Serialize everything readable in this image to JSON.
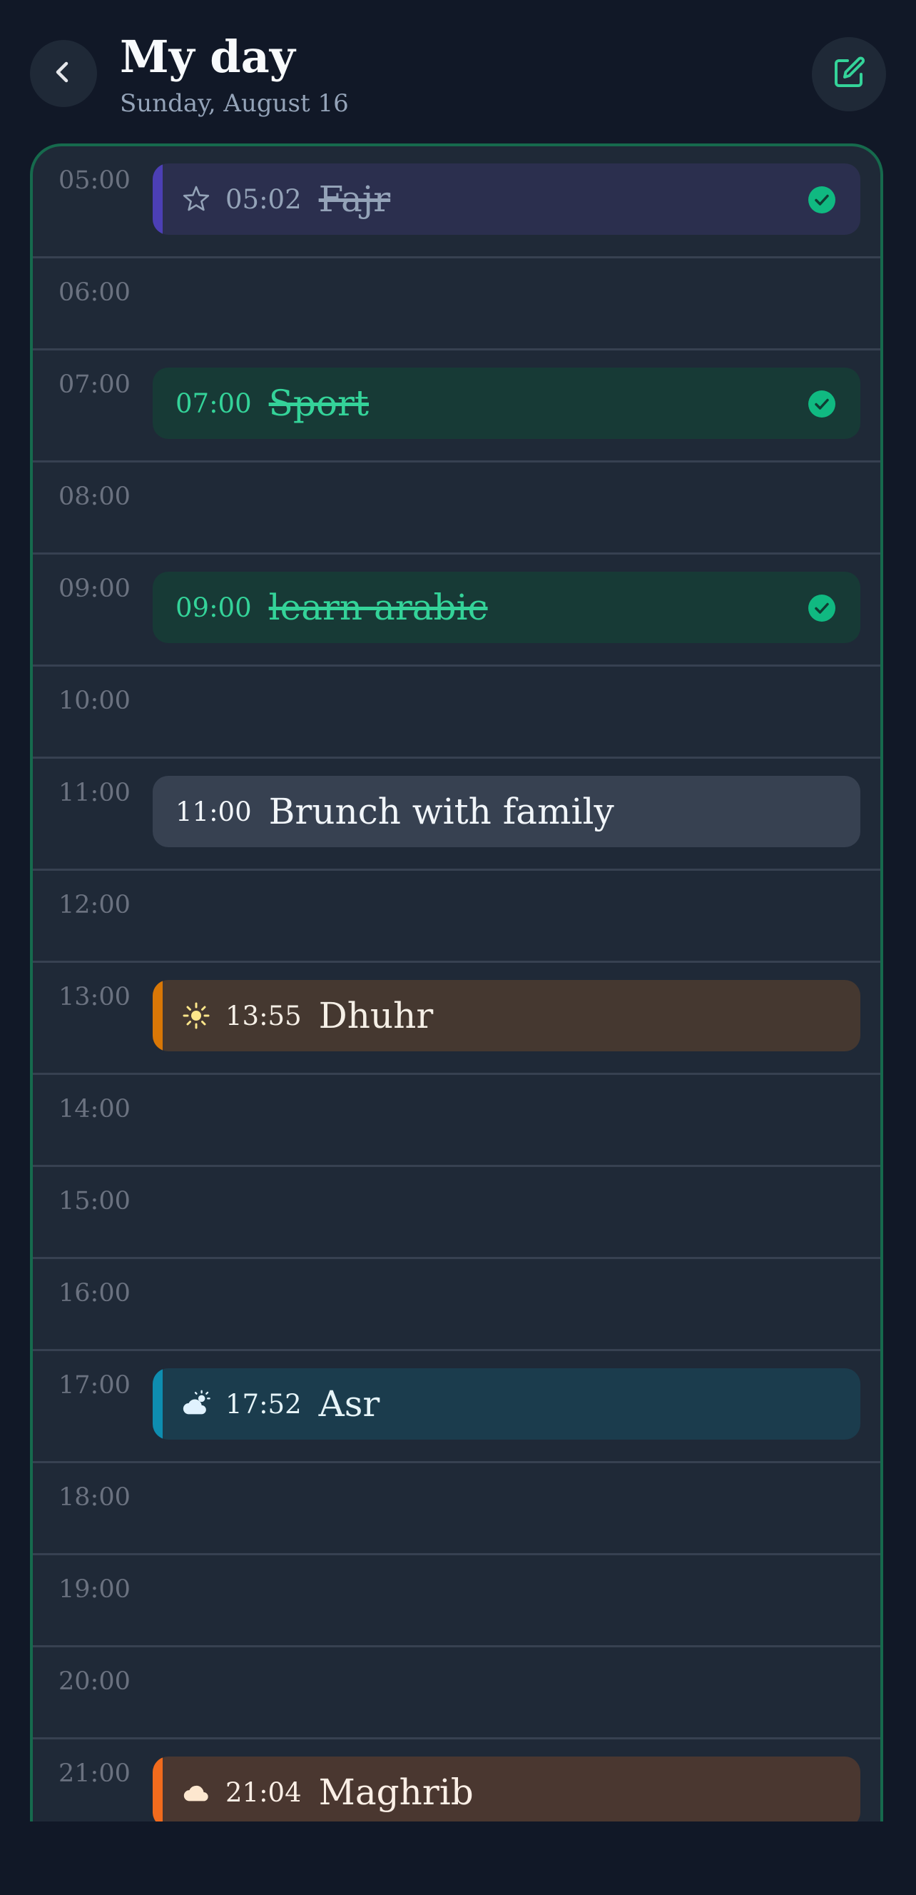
{
  "header": {
    "title": "My day",
    "date": "Sunday, August 16"
  },
  "colors": {
    "background": "#111827",
    "timeline_bg": "#1f2937",
    "timeline_border": "#166a4d",
    "accent_green": "#34d399",
    "check_green": "#10b981"
  },
  "icons": {
    "back": "chevron-left-icon",
    "edit": "edit-note-icon"
  },
  "hours": [
    {
      "label": "05:00",
      "event": {
        "time": "05:02",
        "title": "Fajr",
        "kind": "prayer",
        "icon": "star-icon",
        "done": true,
        "bg": "#2b2f4e",
        "bar": "#4c3fb5",
        "text": "#94a3b8"
      }
    },
    {
      "label": "06:00"
    },
    {
      "label": "07:00",
      "event": {
        "time": "07:00",
        "title": "Sport",
        "kind": "task",
        "done": true,
        "bg": "#173a36",
        "text": "#34d399"
      }
    },
    {
      "label": "08:00"
    },
    {
      "label": "09:00",
      "event": {
        "time": "09:00",
        "title": "learn arabic",
        "kind": "task",
        "done": true,
        "bg": "#173a36",
        "text": "#34d399"
      }
    },
    {
      "label": "10:00"
    },
    {
      "label": "11:00",
      "event": {
        "time": "11:00",
        "title": "Brunch with family",
        "kind": "task",
        "done": false,
        "bg": "#374151",
        "text": "#f1f5f9"
      }
    },
    {
      "label": "12:00"
    },
    {
      "label": "13:00",
      "event": {
        "time": "13:55",
        "title": "Dhuhr",
        "kind": "prayer",
        "icon": "sun-icon",
        "done": false,
        "bg": "#453830",
        "bar": "#d97706",
        "text": "#f5efe6"
      }
    },
    {
      "label": "14:00"
    },
    {
      "label": "15:00"
    },
    {
      "label": "16:00"
    },
    {
      "label": "17:00",
      "event": {
        "time": "17:52",
        "title": "Asr",
        "kind": "prayer",
        "icon": "cloud-sun-icon",
        "done": false,
        "bg": "#1b3c4d",
        "bar": "#0e8db0",
        "text": "#e6f4f8"
      }
    },
    {
      "label": "18:00"
    },
    {
      "label": "19:00"
    },
    {
      "label": "20:00"
    },
    {
      "label": "21:00",
      "event": {
        "time": "21:04",
        "title": "Maghrib",
        "kind": "prayer",
        "icon": "cloud-icon",
        "done": false,
        "bg": "#4a3730",
        "bar": "#f26b1d",
        "text": "#fbefe6"
      }
    }
  ]
}
